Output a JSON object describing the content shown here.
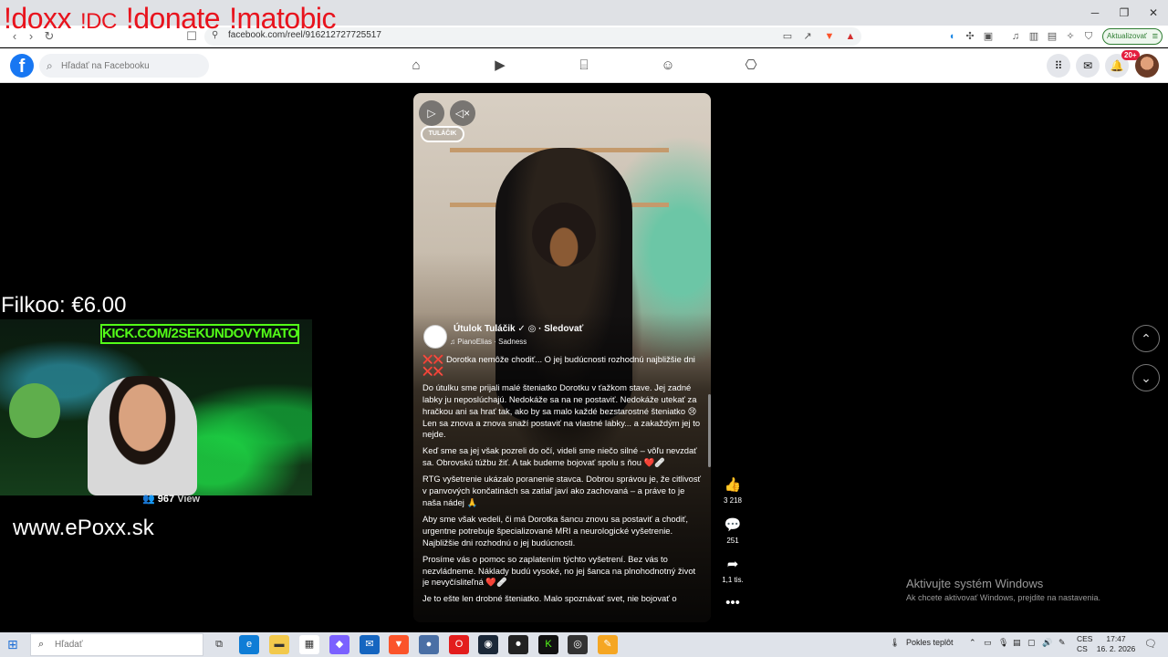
{
  "browser": {
    "url": "facebook.com/reel/916212727725517",
    "update_label": "Aktualizovať"
  },
  "facebook": {
    "search_placeholder": "Hľadať na Facebooku",
    "notification_badge": "20+"
  },
  "overlay": {
    "commands": [
      "!doxx",
      "!DC",
      "!donate",
      "!matobic"
    ],
    "filkoo": "Filkoo: €6.00",
    "kick_banner": "KICK.COM/2SEKUNDOVYMATO",
    "viewer_count": "967",
    "viewer_label": "View",
    "website": "www.ePoxx.sk"
  },
  "reel": {
    "logo": "TULÁČIK",
    "author": "Útulok Tuláčik",
    "follow": "Sledovať",
    "music": "PianoElias · Sadness",
    "caption": [
      "❌❌ Dorotka nemôže chodiť... O jej budúcnosti rozhodnú najbližšie dni ❌❌",
      "Do útulku sme prijali malé šteniatko Dorotku v ťažkom stave. Jej zadné labky ju neposlúchajú. Nedokáže sa na ne postaviť. Nedokáže utekať za hračkou ani sa hrať tak, ako by sa malo každé bezstarostné šteniatko 😢 Len sa znova a znova snaží postaviť na vlastné labky... a zakaždým jej to nejde.",
      "Keď sme sa jej však pozreli do očí, videli sme niečo silné – vôľu nevzdať sa. Obrovskú túžbu žiť. A tak budeme bojovať spolu s ňou ❤️🩹",
      "RTG vyšetrenie ukázalo poranenie stavca. Dobrou správou je, že citlivosť v panvových končatinách sa zatiaľ javí ako zachovaná – a práve to je naša nádej 🙏",
      "Aby sme však vedeli, či má Dorotka šancu znovu sa postaviť a chodiť, urgentne potrebuje špecializované MRI a neurologické vyšetrenie. Najbližšie dni rozhodnú o jej budúcnosti.",
      "Prosíme vás o pomoc so zaplatením týchto vyšetrení. Bez vás to nezvládneme. Náklady budú vysoké, no jej šanca na plnohodnotný život je nevyčísliteľná ❤️🩹",
      "Je to ešte len drobné šteniatko. Malo spoznávať svet, nie bojovať o"
    ],
    "likes": "3 218",
    "comments": "251",
    "shares": "1,1 tis."
  },
  "windows": {
    "activate_title": "Aktivujte systém Windows",
    "activate_sub": "Ak chcete aktivovať Windows, prejdite na nastavenia.",
    "search_placeholder": "Hľadať",
    "weather": "Pokles teplôt",
    "lang_top": "CES",
    "lang_bottom": "CS",
    "time": "17:47",
    "date": "16. 2. 2026"
  },
  "colors": {
    "facebook_blue": "#1877f2",
    "overlay_red": "#e8131d",
    "kick_green": "#53fc18"
  }
}
